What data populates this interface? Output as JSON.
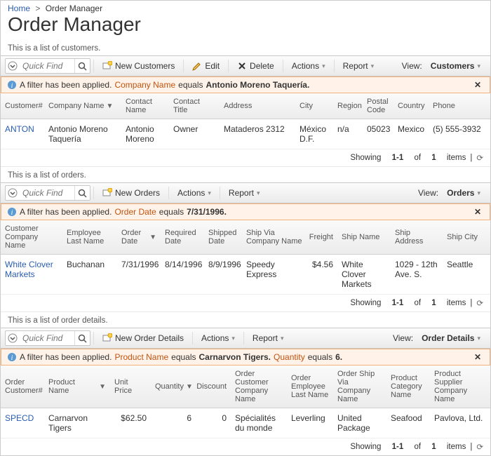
{
  "breadcrumb": {
    "home": "Home",
    "current": "Order Manager"
  },
  "page_title": "Order Manager",
  "customers_section": {
    "desc": "This is a list of customers.",
    "quick_find_placeholder": "Quick Find",
    "buttons": {
      "new": "New Customers",
      "edit": "Edit",
      "delete": "Delete",
      "actions": "Actions",
      "report": "Report"
    },
    "view_label": "View:",
    "view_value": "Customers",
    "filter": {
      "msg": "A filter has been applied.",
      "field": "Company Name",
      "op": "equals",
      "value": "Antonio Moreno Taquería"
    },
    "cols": [
      "Customer#",
      "Company Name",
      "Contact Name",
      "Contact Title",
      "Address",
      "City",
      "Region",
      "Postal Code",
      "Country",
      "Phone"
    ],
    "row": {
      "id": "ANTON",
      "company": "Antonio Moreno Taquería",
      "contact": "Antonio Moreno",
      "title": "Owner",
      "address": "Mataderos 2312",
      "city": "México D.F.",
      "region": "n/a",
      "postal": "05023",
      "country": "Mexico",
      "phone": "(5) 555-3932"
    },
    "pager": {
      "prefix": "Showing",
      "range": "1-1",
      "mid": "of",
      "total": "1",
      "suffix": "items"
    }
  },
  "orders_section": {
    "desc": "This is a list of orders.",
    "quick_find_placeholder": "Quick Find",
    "buttons": {
      "new": "New Orders",
      "actions": "Actions",
      "report": "Report"
    },
    "view_label": "View:",
    "view_value": "Orders",
    "filter": {
      "msg": "A filter has been applied.",
      "field": "Order Date",
      "op": "equals",
      "value": "7/31/1996"
    },
    "cols": [
      "Customer Company Name",
      "Employee Last Name",
      "Order Date",
      "Required Date",
      "Shipped Date",
      "Ship Via Company Name",
      "Freight",
      "Ship Name",
      "Ship Address",
      "Ship City"
    ],
    "row": {
      "cust": "White Clover Markets",
      "emp": "Buchanan",
      "odate": "7/31/1996",
      "rdate": "8/14/1996",
      "sdate": "8/9/1996",
      "shipvia": "Speedy Express",
      "freight": "$4.56",
      "shipname": "White Clover Markets",
      "shipaddr": "1029 - 12th Ave. S.",
      "shipcity": "Seattle"
    },
    "pager": {
      "prefix": "Showing",
      "range": "1-1",
      "mid": "of",
      "total": "1",
      "suffix": "items"
    }
  },
  "details_section": {
    "desc": "This is a list of order details.",
    "quick_find_placeholder": "Quick Find",
    "buttons": {
      "new": "New Order Details",
      "actions": "Actions",
      "report": "Report"
    },
    "view_label": "View:",
    "view_value": "Order Details",
    "filter": {
      "msg": "A filter has been applied.",
      "f1": "Product Name",
      "op1": "equals",
      "v1": "Carnarvon Tigers",
      "f2": "Quantity",
      "op2": "equals",
      "v2": "6"
    },
    "cols": [
      "Order Customer#",
      "Product Name",
      "Unit Price",
      "Quantity",
      "Discount",
      "Order Customer Company Name",
      "Order Employee Last Name",
      "Order Ship Via Company Name",
      "Product Category Name",
      "Product Supplier Company Name"
    ],
    "row": {
      "cust": "SPECD",
      "product": "Carnarvon Tigers",
      "price": "$62.50",
      "qty": "6",
      "disc": "0",
      "ocust": "Spécialités du monde",
      "oemp": "Leverling",
      "oship": "United Package",
      "cat": "Seafood",
      "supp": "Pavlova, Ltd."
    },
    "pager": {
      "prefix": "Showing",
      "range": "1-1",
      "mid": "of",
      "total": "1",
      "suffix": "items"
    }
  }
}
